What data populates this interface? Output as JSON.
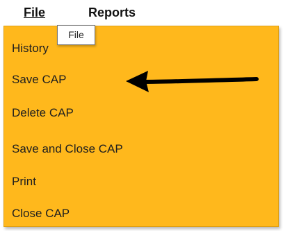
{
  "menubar": {
    "file_label": "File",
    "reports_label": "Reports"
  },
  "tooltip": {
    "text": "File"
  },
  "dropdown": {
    "background_color": "#ffb81c",
    "items": [
      {
        "label": "History"
      },
      {
        "label": "Save CAP"
      },
      {
        "label": "Delete CAP"
      },
      {
        "label": "Save and Close CAP"
      },
      {
        "label": "Print"
      },
      {
        "label": "Close CAP"
      }
    ]
  },
  "annotation": {
    "type": "arrow",
    "points_to": "Save CAP",
    "color": "#000000"
  }
}
